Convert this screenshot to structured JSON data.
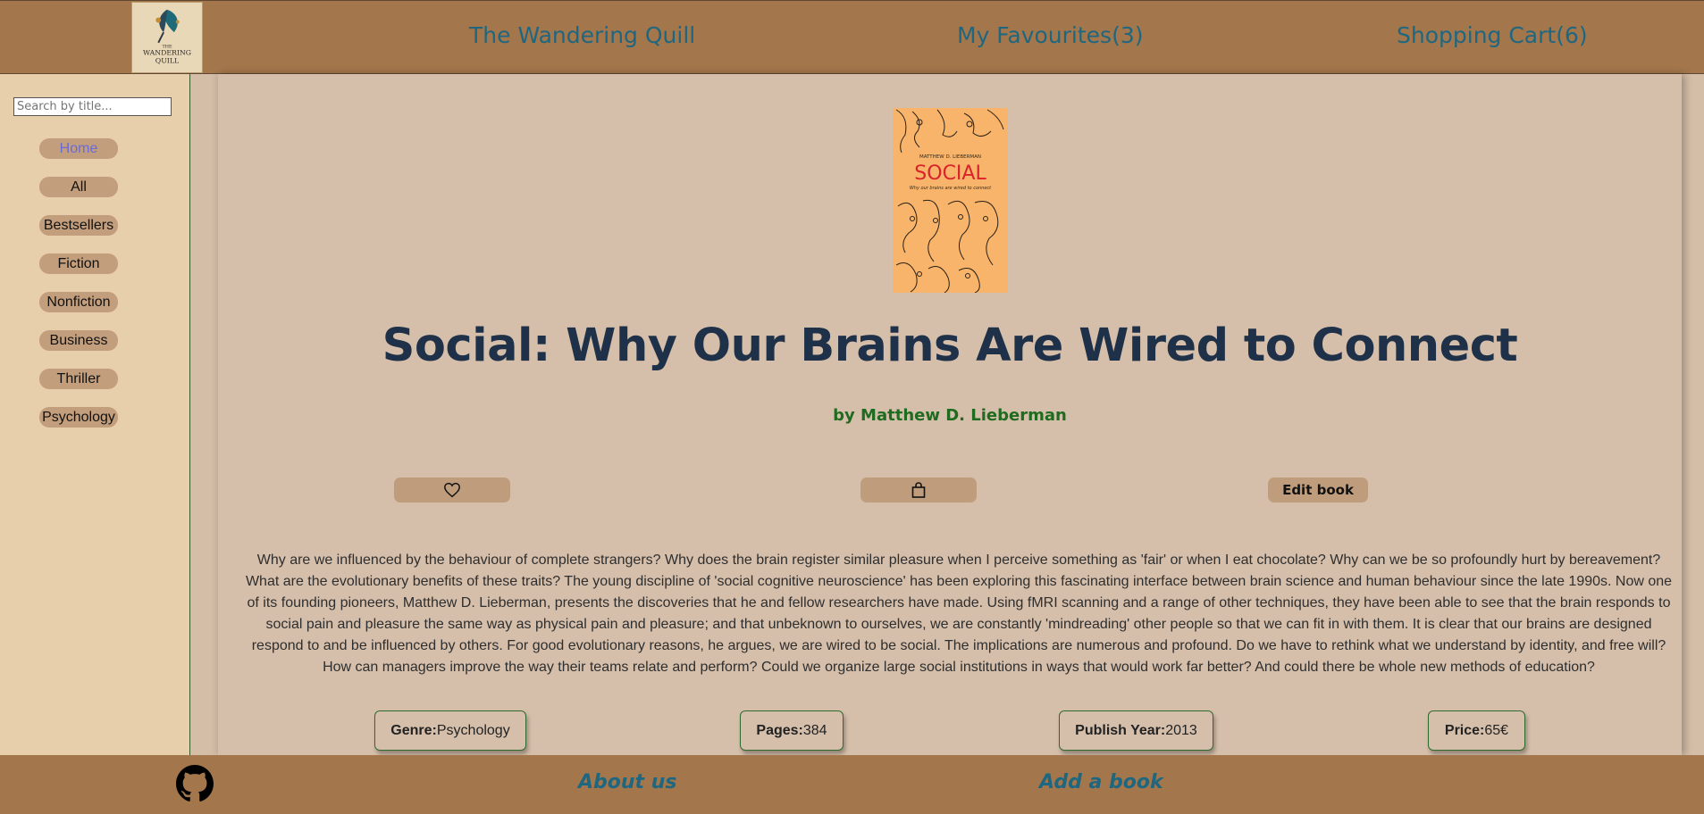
{
  "header": {
    "logo_text": [
      "THE",
      "WANDERING",
      "QUILL"
    ],
    "site_title": "The Wandering Quill",
    "favourites_link": "My Favourites(3)",
    "cart_link": "Shopping Cart(6)"
  },
  "sidebar": {
    "search_placeholder": "Search by title...",
    "search_value": "",
    "categories": [
      {
        "label": "Home",
        "active": true
      },
      {
        "label": "All",
        "active": false
      },
      {
        "label": "Bestsellers",
        "active": false
      },
      {
        "label": "Fiction",
        "active": false
      },
      {
        "label": "Nonfiction",
        "active": false
      },
      {
        "label": "Business",
        "active": false
      },
      {
        "label": "Thriller",
        "active": false
      },
      {
        "label": "Psychology",
        "active": false
      }
    ]
  },
  "book": {
    "cover": {
      "author_line": "MATTHEW D. LIEBERMAN",
      "title": "SOCIAL",
      "subtitle": "Why our brains are wired to connect"
    },
    "title": "Social: Why Our Brains Are Wired to Connect",
    "author": "by Matthew D. Lieberman",
    "favourite_icon": "heart-icon",
    "cart_icon": "shopping-bag-icon",
    "edit_label": "Edit book",
    "description": "Why are we influenced by the behaviour of complete strangers? Why does the brain register similar pleasure when I perceive something as 'fair' or when I eat chocolate? Why can we be so profoundly hurt by bereavement? What are the evolutionary benefits of these traits? The young discipline of 'social cognitive neuroscience' has been exploring this fascinating interface between brain science and human behaviour since the late 1990s. Now one of its founding pioneers, Matthew D. Lieberman, presents the discoveries that he and fellow researchers have made. Using fMRI scanning and a range of other techniques, they have been able to see that the brain responds to social pain and pleasure the same way as physical pain and pleasure; and that unbeknown to ourselves, we are constantly 'mindreading' other people so that we can fit in with them. It is clear that our brains are designed respond to and be influenced by others. For good evolutionary reasons, he argues, we are wired to be social. The implications are numerous and profound. Do we have to rethink what we understand by identity, and free will? How can managers improve the way their teams relate and perform? Could we organize large social institutions in ways that would work far better? And could there be whole new methods of education?",
    "info": {
      "genre_label": "Genre:",
      "genre": "Psychology",
      "pages_label": "Pages:",
      "pages": "384",
      "year_label": "Publish Year:",
      "year": "2013",
      "price_label": "Price:",
      "price": "65€"
    }
  },
  "footer": {
    "github_icon": "github-icon",
    "about": "About us",
    "add_book": "Add a book"
  },
  "colors": {
    "header_bg": "#a3764b",
    "sidebar_bg": "#e8cfab",
    "content_bg": "#d5bfab",
    "link": "#1f6780",
    "title": "#1e3148",
    "author": "#1f6b1f",
    "button_bg": "#bf9d7c",
    "active_category": "#6a6bd6"
  }
}
